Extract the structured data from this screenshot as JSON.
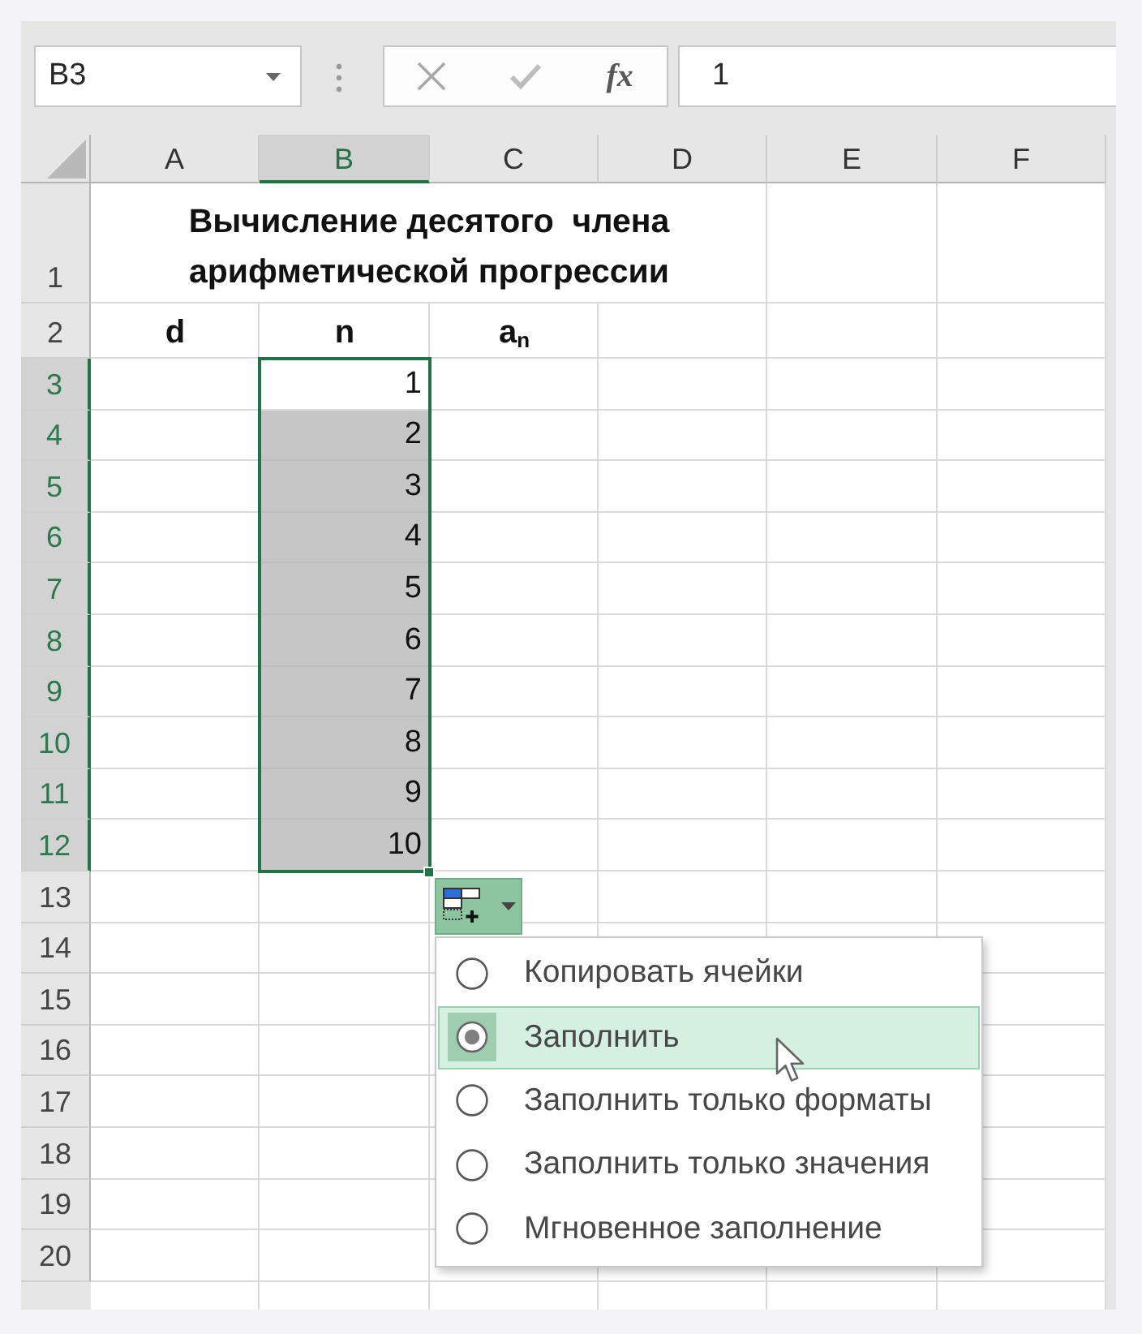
{
  "name_box": {
    "value": "B3"
  },
  "formula_bar": {
    "function_label": "fx",
    "value": "1"
  },
  "sheet": {
    "columns": [
      {
        "label": "A",
        "selected": false
      },
      {
        "label": "B",
        "selected": true
      },
      {
        "label": "C",
        "selected": false
      },
      {
        "label": "D",
        "selected": false
      },
      {
        "label": "E",
        "selected": false
      },
      {
        "label": "F",
        "selected": false
      }
    ],
    "rows": [
      {
        "label": "1",
        "selected": false
      },
      {
        "label": "2",
        "selected": false
      },
      {
        "label": "3",
        "selected": true
      },
      {
        "label": "4",
        "selected": true
      },
      {
        "label": "5",
        "selected": true
      },
      {
        "label": "6",
        "selected": true
      },
      {
        "label": "7",
        "selected": true
      },
      {
        "label": "8",
        "selected": true
      },
      {
        "label": "9",
        "selected": true
      },
      {
        "label": "10",
        "selected": true
      },
      {
        "label": "11",
        "selected": true
      },
      {
        "label": "12",
        "selected": true
      },
      {
        "label": "13",
        "selected": false
      },
      {
        "label": "14",
        "selected": false
      },
      {
        "label": "15",
        "selected": false
      },
      {
        "label": "16",
        "selected": false
      },
      {
        "label": "17",
        "selected": false
      },
      {
        "label": "18",
        "selected": false
      },
      {
        "label": "19",
        "selected": false
      },
      {
        "label": "20",
        "selected": false
      }
    ],
    "title": "Вычисление десятого  члена арифметической прогрессии",
    "headings": [
      "d",
      "n",
      "a$_{n}$"
    ],
    "values": [
      {
        "text": "1",
        "active": true
      },
      {
        "text": "2",
        "active": false
      },
      {
        "text": "3",
        "active": false
      },
      {
        "text": "4",
        "active": false
      },
      {
        "text": "5",
        "active": false
      },
      {
        "text": "6",
        "active": false
      },
      {
        "text": "7",
        "active": false
      },
      {
        "text": "8",
        "active": false
      },
      {
        "text": "9",
        "active": false
      },
      {
        "text": "10",
        "active": false
      }
    ]
  },
  "autofill_options": {
    "expanded": true,
    "items": [
      {
        "label": "Копировать ячейки",
        "selected": false,
        "highlighted": false
      },
      {
        "label": "Заполнить",
        "selected": true,
        "highlighted": true
      },
      {
        "label": "Заполнить только форматы",
        "selected": false,
        "highlighted": false
      },
      {
        "label": "Заполнить только значения",
        "selected": false,
        "highlighted": false
      },
      {
        "label": "Мгновенное заполнение",
        "selected": false,
        "highlighted": false
      }
    ]
  }
}
